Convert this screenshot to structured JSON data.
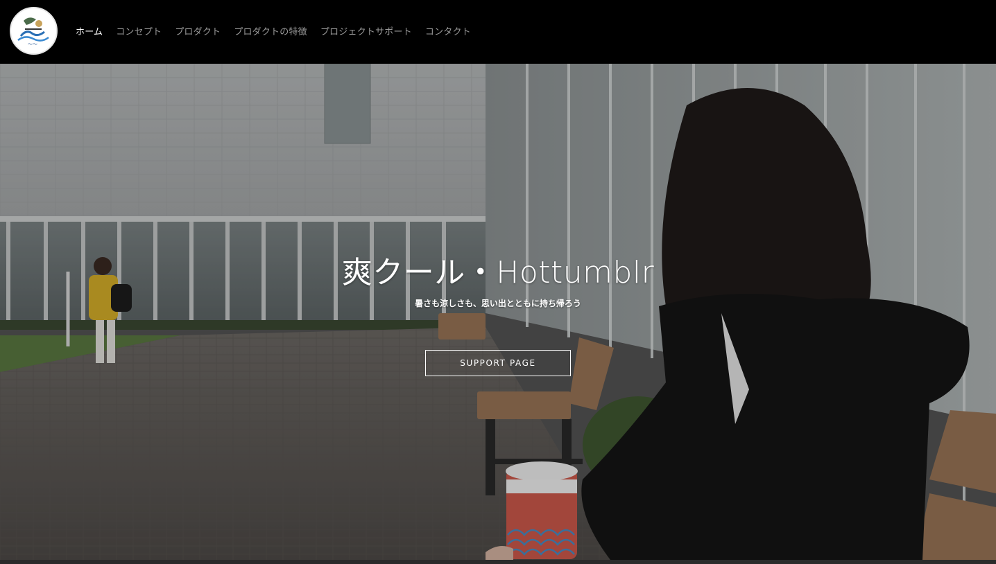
{
  "header": {
    "logo_icon": "brand-logo-icon",
    "nav": [
      {
        "label": "ホーム",
        "active": true
      },
      {
        "label": "コンセプト",
        "active": false
      },
      {
        "label": "プロダクト",
        "active": false
      },
      {
        "label": "プロダクトの特徴",
        "active": false
      },
      {
        "label": "プロジェクトサポート",
        "active": false
      },
      {
        "label": "コンタクト",
        "active": false
      }
    ]
  },
  "hero": {
    "title": "爽クール・Hottumblr",
    "subtitle": "暑さも涼しさも、思い出とともに持ち帰ろう",
    "button_label": "SUPPORT PAGE",
    "image": "hero-background-photo"
  },
  "colors": {
    "header_bg": "#000000",
    "nav_active": "#ffffff",
    "nav_inactive": "#9a9a9a"
  }
}
